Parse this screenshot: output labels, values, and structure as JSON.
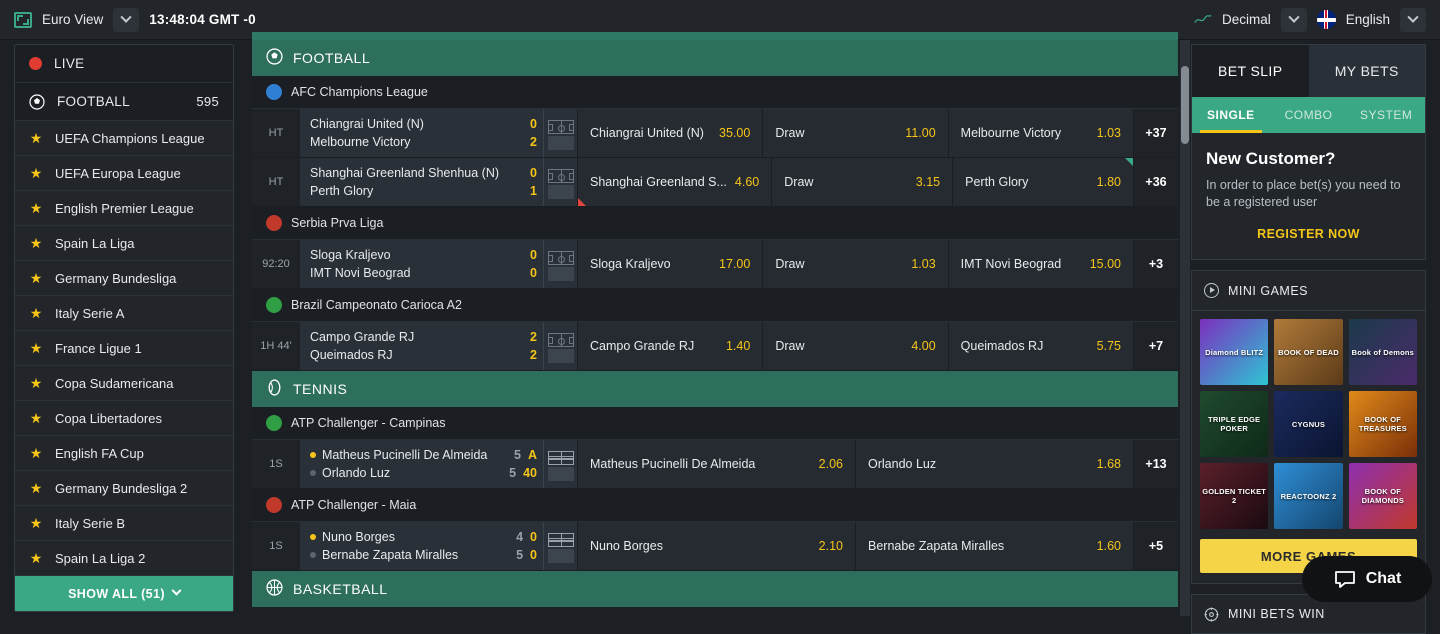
{
  "topbar": {
    "view_icon": "expand-icon",
    "view_label": "Euro View",
    "time": "13:48:04 GMT -0",
    "odds_icon": "decimal-odds-icon",
    "odds_format": "Decimal",
    "lang_flag": "uk-flag-icon",
    "language": "English"
  },
  "sidebar": {
    "live": {
      "label": "LIVE",
      "icon": "live-dot-icon"
    },
    "football": {
      "label": "FOOTBALL",
      "count": "595",
      "icon": "football-icon"
    },
    "leagues": [
      {
        "label": "UEFA Champions League",
        "icon": "star-icon"
      },
      {
        "label": "UEFA Europa League",
        "icon": "star-icon"
      },
      {
        "label": "English Premier League",
        "icon": "star-icon"
      },
      {
        "label": "Spain La Liga",
        "icon": "star-icon"
      },
      {
        "label": "Germany Bundesliga",
        "icon": "star-icon"
      },
      {
        "label": "Italy Serie A",
        "icon": "star-icon"
      },
      {
        "label": "France Ligue 1",
        "icon": "star-icon"
      },
      {
        "label": "Copa Sudamericana",
        "icon": "star-icon"
      },
      {
        "label": "Copa Libertadores",
        "icon": "star-icon"
      },
      {
        "label": "English FA Cup",
        "icon": "star-icon"
      },
      {
        "label": "Germany Bundesliga 2",
        "icon": "star-icon"
      },
      {
        "label": "Italy Serie B",
        "icon": "star-icon"
      },
      {
        "label": "Spain La Liga 2",
        "icon": "star-icon"
      }
    ],
    "show_all": "SHOW ALL (51)"
  },
  "main": {
    "sports": [
      {
        "name": "FOOTBALL",
        "icon": "football-icon",
        "leagues": [
          {
            "name": "AFC Champions League",
            "badge_color": "#2f7fd4",
            "matches": [
              {
                "time": "HT",
                "home": "Chiangrai United (N)",
                "away": "Melbourne Victory",
                "home_score": "0",
                "away_score": "2",
                "pitch_icon": "pitch-icon",
                "odds": [
                  {
                    "name": "Chiangrai United (N)",
                    "value": "35.00",
                    "move": "none"
                  },
                  {
                    "name": "Draw",
                    "value": "11.00",
                    "move": "none"
                  },
                  {
                    "name": "Melbourne Victory",
                    "value": "1.03",
                    "move": "none"
                  }
                ],
                "more": "+37"
              },
              {
                "time": "HT",
                "home": "Shanghai Greenland Shenhua (N)",
                "away": "Perth Glory",
                "home_score": "0",
                "away_score": "1",
                "pitch_icon": "pitch-icon",
                "odds": [
                  {
                    "name": "Shanghai Greenland S...",
                    "value": "4.60",
                    "move": "down"
                  },
                  {
                    "name": "Draw",
                    "value": "3.15",
                    "move": "none"
                  },
                  {
                    "name": "Perth Glory",
                    "value": "1.80",
                    "move": "up"
                  }
                ],
                "more": "+36"
              }
            ]
          },
          {
            "name": "Serbia Prva Liga",
            "badge_color": "#c0392b",
            "matches": [
              {
                "time": "92:20",
                "home": "Sloga Kraljevo",
                "away": "IMT Novi Beograd",
                "home_score": "0",
                "away_score": "0",
                "pitch_icon": "pitch-icon",
                "odds": [
                  {
                    "name": "Sloga Kraljevo",
                    "value": "17.00",
                    "move": "none"
                  },
                  {
                    "name": "Draw",
                    "value": "1.03",
                    "move": "none"
                  },
                  {
                    "name": "IMT Novi Beograd",
                    "value": "15.00",
                    "move": "none"
                  }
                ],
                "more": "+3"
              }
            ]
          },
          {
            "name": "Brazil Campeonato Carioca A2",
            "badge_color": "#2f9e44",
            "matches": [
              {
                "time": "1H 44'",
                "home": "Campo Grande RJ",
                "away": "Queimados RJ",
                "home_score": "2",
                "away_score": "2",
                "pitch_icon": "pitch-icon",
                "odds": [
                  {
                    "name": "Campo Grande RJ",
                    "value": "1.40",
                    "move": "none"
                  },
                  {
                    "name": "Draw",
                    "value": "4.00",
                    "move": "none"
                  },
                  {
                    "name": "Queimados RJ",
                    "value": "5.75",
                    "move": "none"
                  }
                ],
                "more": "+7"
              }
            ]
          }
        ]
      },
      {
        "name": "TENNIS",
        "icon": "tennis-icon",
        "leagues": [
          {
            "name": "ATP Challenger - Campinas",
            "badge_color": "#2f9e44",
            "matches": [
              {
                "time": "1S",
                "home": "Matheus Pucinelli De Almeida",
                "away": "Orlando Luz",
                "home_set": "5",
                "home_game": "A",
                "away_set": "5",
                "away_game": "40",
                "serving": "home",
                "pitch_icon": "tennis-court-icon",
                "odds": [
                  {
                    "name": "Matheus Pucinelli De Almeida",
                    "value": "2.06",
                    "move": "none"
                  },
                  {
                    "name": "Orlando Luz",
                    "value": "1.68",
                    "move": "none"
                  }
                ],
                "more": "+13"
              }
            ]
          },
          {
            "name": "ATP Challenger - Maia",
            "badge_color": "#c0392b",
            "matches": [
              {
                "time": "1S",
                "home": "Nuno Borges",
                "away": "Bernabe Zapata Miralles",
                "home_set": "4",
                "home_game": "0",
                "away_set": "5",
                "away_game": "0",
                "serving": "home",
                "pitch_icon": "tennis-court-icon",
                "odds": [
                  {
                    "name": "Nuno Borges",
                    "value": "2.10",
                    "move": "none"
                  },
                  {
                    "name": "Bernabe Zapata Miralles",
                    "value": "1.60",
                    "move": "none"
                  }
                ],
                "more": "+5"
              }
            ]
          }
        ]
      },
      {
        "name": "BASKETBALL",
        "icon": "basketball-icon",
        "leagues": []
      }
    ]
  },
  "betslip": {
    "tabs": [
      {
        "label": "BET SLIP",
        "active": true
      },
      {
        "label": "MY BETS",
        "active": false
      }
    ],
    "subtabs": [
      {
        "label": "SINGLE",
        "active": true
      },
      {
        "label": "COMBO",
        "active": false
      },
      {
        "label": "SYSTEM",
        "active": false
      }
    ],
    "title": "New Customer?",
    "text": "In order to place bet(s) you need to be a registered user",
    "register": "REGISTER NOW"
  },
  "minigames": {
    "header": "MINI GAMES",
    "header_icon": "play-circle-icon",
    "tiles": [
      {
        "label": "Diamond BLITZ",
        "c1": "#7b2fbe",
        "c2": "#2ec5d3"
      },
      {
        "label": "BOOK OF DEAD",
        "c1": "#b07b3a",
        "c2": "#5c3a18"
      },
      {
        "label": "Book of Demons",
        "c1": "#1b3a4b",
        "c2": "#4b2b6b"
      },
      {
        "label": "TRIPLE EDGE POKER",
        "c1": "#1f4a2e",
        "c2": "#0e2a18"
      },
      {
        "label": "CYGNUS",
        "c1": "#1b2a5e",
        "c2": "#0a1430"
      },
      {
        "label": "BOOK OF TREASURES",
        "c1": "#e08a1a",
        "c2": "#7a2f08"
      },
      {
        "label": "GOLDEN TICKET 2",
        "c1": "#5b1f2a",
        "c2": "#1a0a10"
      },
      {
        "label": "REACTOONZ 2",
        "c1": "#2f8fd6",
        "c2": "#14456e"
      },
      {
        "label": "BOOK OF DIAMONDS",
        "c1": "#8e2fb0",
        "c2": "#c0392b"
      }
    ],
    "more_button": "MORE GAMES"
  },
  "bottom_panel": {
    "label": "MINI BETS WIN",
    "icon": "target-icon"
  },
  "chat": {
    "label": "Chat",
    "icon": "chat-bubble-icon"
  },
  "colors": {
    "accent_green": "#3aa884",
    "sport_header": "#2d6e5c",
    "odds_yellow": "#f5c518",
    "up_arrow": "#3aa884",
    "down_arrow": "#e0453c",
    "live_red": "#e03c31",
    "page_bg": "#1c2024"
  }
}
